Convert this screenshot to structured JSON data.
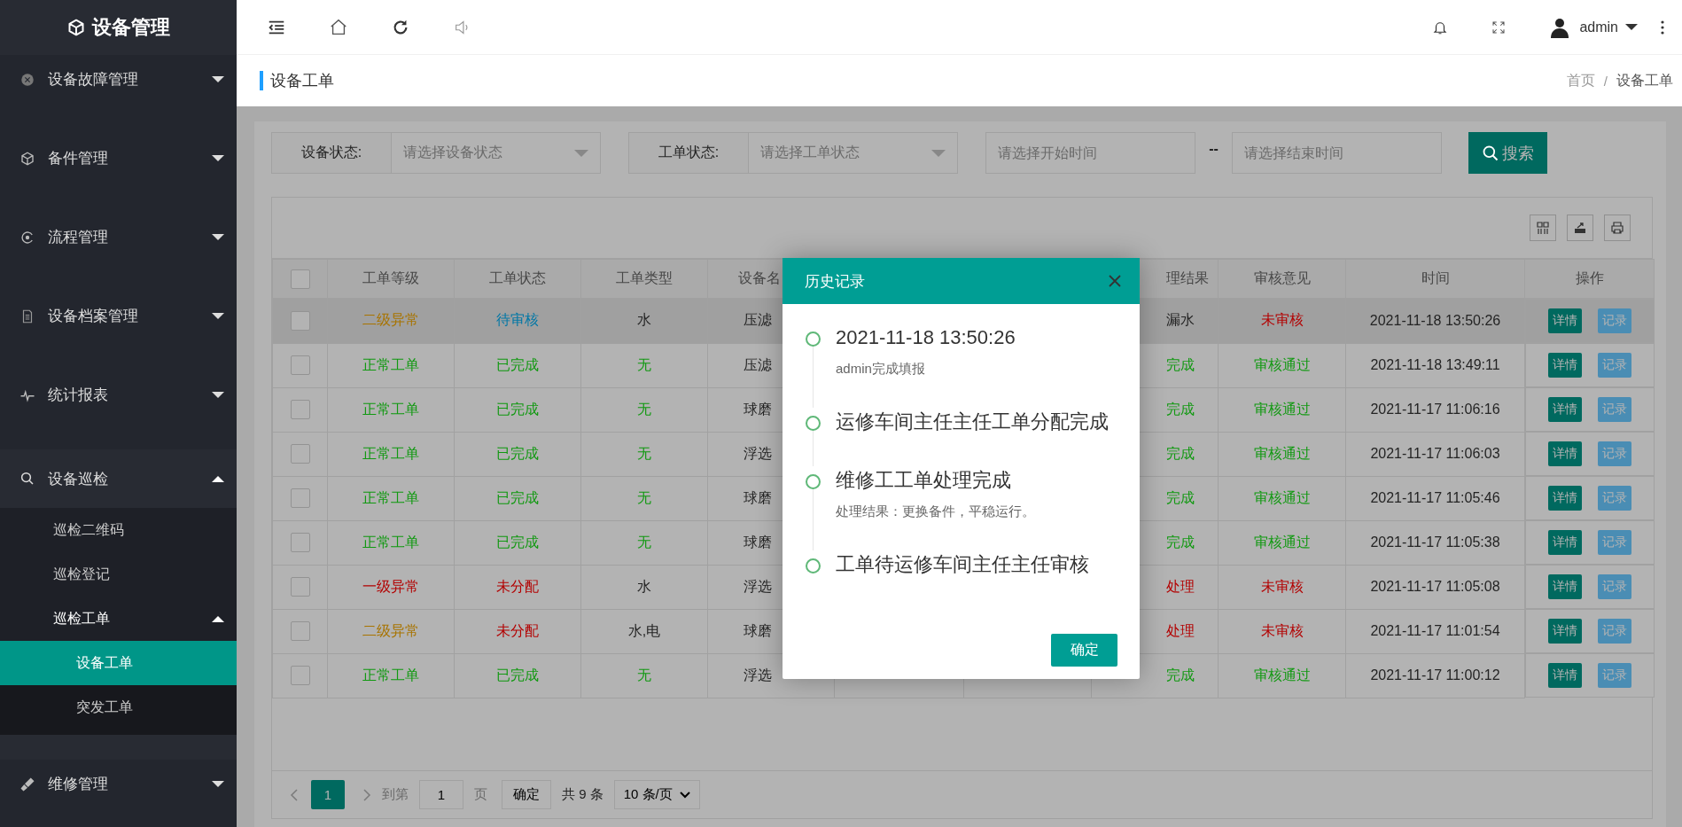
{
  "sidebar": {
    "logo": "设备管理",
    "menu": [
      {
        "label": "设备故障管理",
        "expanded": false
      },
      {
        "label": "备件管理",
        "expanded": false
      },
      {
        "label": "流程管理",
        "expanded": false
      },
      {
        "label": "设备档案管理",
        "expanded": false
      },
      {
        "label": "统计报表",
        "expanded": false
      },
      {
        "label": "设备巡检",
        "expanded": true,
        "children": [
          {
            "label": "巡检二维码",
            "selected": false
          },
          {
            "label": "巡检登记",
            "selected": false
          },
          {
            "label": "巡检工单",
            "expanded": true,
            "children": [
              {
                "label": "设备工单",
                "selected": true
              },
              {
                "label": "突发工单",
                "selected": false
              }
            ]
          }
        ]
      },
      {
        "label": "维修管理",
        "expanded": false
      }
    ]
  },
  "topbar": {
    "user": "admin"
  },
  "page_title": "设备工单",
  "breadcrumb": {
    "items": [
      "首页",
      "设备工单"
    ],
    "separator": "/"
  },
  "filters": {
    "device_status": {
      "label": "设备状态:",
      "placeholder": "请选择设备状态"
    },
    "order_status": {
      "label": "工单状态:",
      "placeholder": "请选择工单状态"
    },
    "start": {
      "placeholder": "请选择开始时间"
    },
    "range_separator": "--",
    "end": {
      "placeholder": "请选择结束时间"
    },
    "search": "搜索"
  },
  "table": {
    "header_checked": false,
    "columns": [
      "工单等级",
      "工单状态",
      "工单类型",
      "设备名",
      "理结果",
      "审核意见",
      "时间",
      "操作"
    ],
    "rows": [
      {
        "selected": true,
        "checked": false,
        "cells": [
          {
            "text": "二级异常",
            "color": "#a87400"
          },
          {
            "text": "待审核",
            "color": "#0177a6"
          },
          {
            "text": "水",
            "color": "#242424"
          },
          {
            "text": "压滤",
            "color": "#242424"
          },
          {
            "text": "漏水",
            "color": "#242424"
          },
          {
            "text": "未审核",
            "color": "#b30000"
          },
          {
            "text": "2021-11-18 13:50:26",
            "color": "#242424"
          }
        ],
        "actions": [
          "详情",
          "记录"
        ]
      },
      {
        "selected": false,
        "checked": false,
        "cells": [
          {
            "text": "正常工单",
            "color": "#119911"
          },
          {
            "text": "已完成",
            "color": "#119911"
          },
          {
            "text": "无",
            "color": "#119911"
          },
          {
            "text": "压滤",
            "color": "#242424"
          },
          {
            "text": "完成",
            "color": "#119911"
          },
          {
            "text": "审核通过",
            "color": "#119911"
          },
          {
            "text": "2021-11-18 13:49:11",
            "color": "#242424"
          }
        ],
        "actions": [
          "详情",
          "记录"
        ]
      },
      {
        "selected": false,
        "checked": false,
        "cells": [
          {
            "text": "正常工单",
            "color": "#119911"
          },
          {
            "text": "已完成",
            "color": "#119911"
          },
          {
            "text": "无",
            "color": "#119911"
          },
          {
            "text": "球磨",
            "color": "#242424"
          },
          {
            "text": "完成",
            "color": "#119911"
          },
          {
            "text": "审核通过",
            "color": "#119911"
          },
          {
            "text": "2021-11-17 11:06:16",
            "color": "#242424"
          }
        ],
        "actions": [
          "详情",
          "记录"
        ]
      },
      {
        "selected": false,
        "checked": false,
        "cells": [
          {
            "text": "正常工单",
            "color": "#119911"
          },
          {
            "text": "已完成",
            "color": "#119911"
          },
          {
            "text": "无",
            "color": "#119911"
          },
          {
            "text": "浮选",
            "color": "#242424"
          },
          {
            "text": "完成",
            "color": "#119911"
          },
          {
            "text": "审核通过",
            "color": "#119911"
          },
          {
            "text": "2021-11-17 11:06:03",
            "color": "#242424"
          }
        ],
        "actions": [
          "详情",
          "记录"
        ]
      },
      {
        "selected": false,
        "checked": false,
        "cells": [
          {
            "text": "正常工单",
            "color": "#119911"
          },
          {
            "text": "已完成",
            "color": "#119911"
          },
          {
            "text": "无",
            "color": "#119911"
          },
          {
            "text": "球磨",
            "color": "#242424"
          },
          {
            "text": "完成",
            "color": "#119911"
          },
          {
            "text": "审核通过",
            "color": "#119911"
          },
          {
            "text": "2021-11-17 11:05:46",
            "color": "#242424"
          }
        ],
        "actions": [
          "详情",
          "记录"
        ]
      },
      {
        "selected": false,
        "checked": false,
        "cells": [
          {
            "text": "正常工单",
            "color": "#119911"
          },
          {
            "text": "已完成",
            "color": "#119911"
          },
          {
            "text": "无",
            "color": "#119911"
          },
          {
            "text": "球磨",
            "color": "#242424"
          },
          {
            "text": "完成",
            "color": "#119911"
          },
          {
            "text": "审核通过",
            "color": "#119911"
          },
          {
            "text": "2021-11-17 11:05:38",
            "color": "#242424"
          }
        ],
        "actions": [
          "详情",
          "记录"
        ]
      },
      {
        "selected": false,
        "checked": false,
        "cells": [
          {
            "text": "一级异常",
            "color": "#b30000"
          },
          {
            "text": "未分配",
            "color": "#b30000"
          },
          {
            "text": "水",
            "color": "#242424"
          },
          {
            "text": "浮选",
            "color": "#242424"
          },
          {
            "text": "处理",
            "color": "#b30000"
          },
          {
            "text": "未审核",
            "color": "#b30000"
          },
          {
            "text": "2021-11-17 11:05:08",
            "color": "#242424"
          }
        ],
        "actions": [
          "详情",
          "记录"
        ]
      },
      {
        "selected": false,
        "checked": false,
        "cells": [
          {
            "text": "二级异常",
            "color": "#a87400"
          },
          {
            "text": "未分配",
            "color": "#b30000"
          },
          {
            "text": "水,电",
            "color": "#242424"
          },
          {
            "text": "球磨",
            "color": "#242424"
          },
          {
            "text": "处理",
            "color": "#b30000"
          },
          {
            "text": "未审核",
            "color": "#b30000"
          },
          {
            "text": "2021-11-17 11:01:54",
            "color": "#242424"
          }
        ],
        "actions": [
          "详情",
          "记录"
        ]
      },
      {
        "selected": false,
        "checked": false,
        "cells": [
          {
            "text": "正常工单",
            "color": "#119911"
          },
          {
            "text": "已完成",
            "color": "#119911"
          },
          {
            "text": "无",
            "color": "#119911"
          },
          {
            "text": "浮选",
            "color": "#242424"
          },
          {
            "text": "完成",
            "color": "#119911"
          },
          {
            "text": "审核通过",
            "color": "#119911"
          },
          {
            "text": "2021-11-17 11:00:12",
            "color": "#242424"
          }
        ],
        "actions": [
          "详情",
          "记录"
        ]
      }
    ]
  },
  "pager": {
    "pages": [
      {
        "label": "1",
        "selected": true
      }
    ],
    "goto_label": "到第",
    "goto_value": "1",
    "page_unit": "页",
    "confirm": "确定",
    "total": "共 9 条",
    "page_size": "10 条/页"
  },
  "modal": {
    "title": "历史记录",
    "timeline": [
      {
        "title": "2021-11-18 13:50:26",
        "note": "admin完成填报"
      },
      {
        "title": "运修车间主任主任工单分配完成"
      },
      {
        "title": "维修工工单处理完成",
        "note": "处理结果：更换备件，平稳运行。"
      },
      {
        "title": "工单待运修车间主任主任审核"
      }
    ],
    "confirm": "确定"
  }
}
